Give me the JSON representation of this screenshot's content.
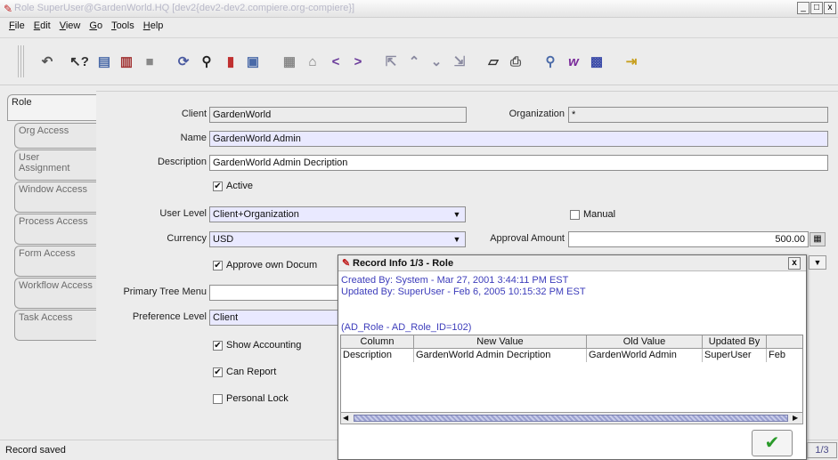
{
  "window": {
    "title": "Role  SuperUser@GardenWorld.HQ [dev2{dev2-dev2.compiere.org-compiere}]"
  },
  "menu": {
    "file": "File",
    "edit": "Edit",
    "view": "View",
    "go": "Go",
    "tools": "Tools",
    "help": "Help"
  },
  "toolbar": {
    "icons": [
      "undo-icon",
      "help-icon",
      "new-icon",
      "delete-icon",
      "save-icon",
      "refresh-icon",
      "find-icon",
      "attachment-icon",
      "history-icon",
      "multi-row-icon",
      "parent-icon",
      "previous-icon",
      "next-icon",
      "first-icon",
      "up-icon",
      "down-icon",
      "last-icon",
      "report-icon",
      "print-icon",
      "zoom-across-icon",
      "workflow-icon",
      "product-info-icon",
      "exit-icon"
    ]
  },
  "tabs": [
    {
      "label": "Role",
      "active": true
    },
    {
      "label": "Org Access"
    },
    {
      "label": "User Assignment"
    },
    {
      "label": "Window Access"
    },
    {
      "label": "Process Access"
    },
    {
      "label": "Form Access"
    },
    {
      "label": "Workflow Access"
    },
    {
      "label": "Task Access"
    }
  ],
  "form": {
    "client_label": "Client",
    "client_value": "GardenWorld",
    "org_label": "Organization",
    "org_value": "*",
    "name_label": "Name",
    "name_value": "GardenWorld Admin",
    "desc_label": "Description",
    "desc_value": "GardenWorld Admin Decription",
    "active_label": "Active",
    "active_checked": true,
    "userlevel_label": "User Level",
    "userlevel_value": "Client+Organization",
    "manual_label": "Manual",
    "manual_checked": false,
    "currency_label": "Currency",
    "currency_value": "USD",
    "approval_label": "Approval Amount",
    "approval_value": "500.00",
    "approve_own_label": "Approve own Docum",
    "approve_own_checked": true,
    "tree_label": "Primary Tree Menu",
    "tree_value": "",
    "preference_label": "Preference Level",
    "preference_value": "Client",
    "show_accounting_label": "Show Accounting",
    "show_accounting_checked": true,
    "can_report_label": "Can Report",
    "can_report_checked": true,
    "personal_lock_label": "Personal Lock",
    "personal_lock_checked": false
  },
  "dialog": {
    "title": "Record Info  1/3 - Role",
    "created": "Created By: System - Mar 27, 2001 3:44:11 PM EST",
    "updated": "Updated By: SuperUser - Feb 6, 2005 10:15:32 PM EST",
    "record_id": "(AD_Role - AD_Role_ID=102)",
    "columns": [
      "Column",
      "New Value",
      "Old Value",
      "Updated By"
    ],
    "row": [
      "Description",
      "GardenWorld Admin Decription",
      "GardenWorld Admin",
      "SuperUser",
      "Feb"
    ]
  },
  "status": {
    "message": "Record saved",
    "page": "1/3"
  }
}
